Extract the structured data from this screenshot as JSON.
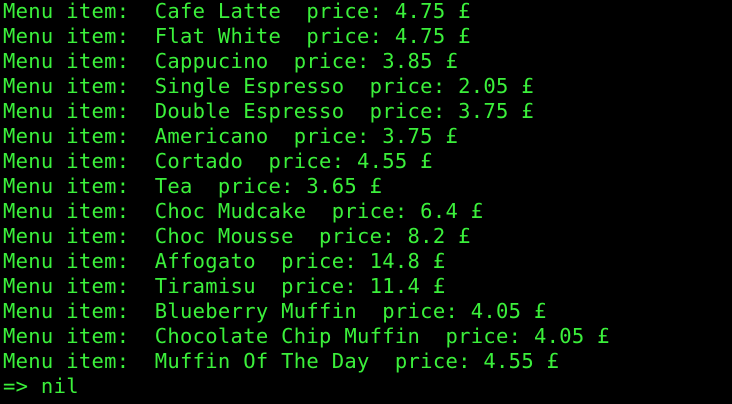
{
  "terminal": {
    "text_color": "#3bf03b",
    "background": "#000000",
    "lines": [
      "Menu item:  Cafe Latte  price: 4.75 £",
      "Menu item:  Flat White  price: 4.75 £",
      "Menu item:  Cappucino  price: 3.85 £",
      "Menu item:  Single Espresso  price: 2.05 £",
      "Menu item:  Double Espresso  price: 3.75 £",
      "Menu item:  Americano  price: 3.75 £",
      "Menu item:  Cortado  price: 4.55 £",
      "Menu item:  Tea  price: 3.65 £",
      "Menu item:  Choc Mudcake  price: 6.4 £",
      "Menu item:  Choc Mousse  price: 8.2 £",
      "Menu item:  Affogato  price: 14.8 £",
      "Menu item:  Tiramisu  price: 11.4 £",
      "Menu item:  Blueberry Muffin  price: 4.05 £",
      "Menu item:  Chocolate Chip Muffin  price: 4.05 £",
      "Menu item:  Muffin Of The Day  price: 4.55 £"
    ],
    "return_line": "=> nil"
  }
}
